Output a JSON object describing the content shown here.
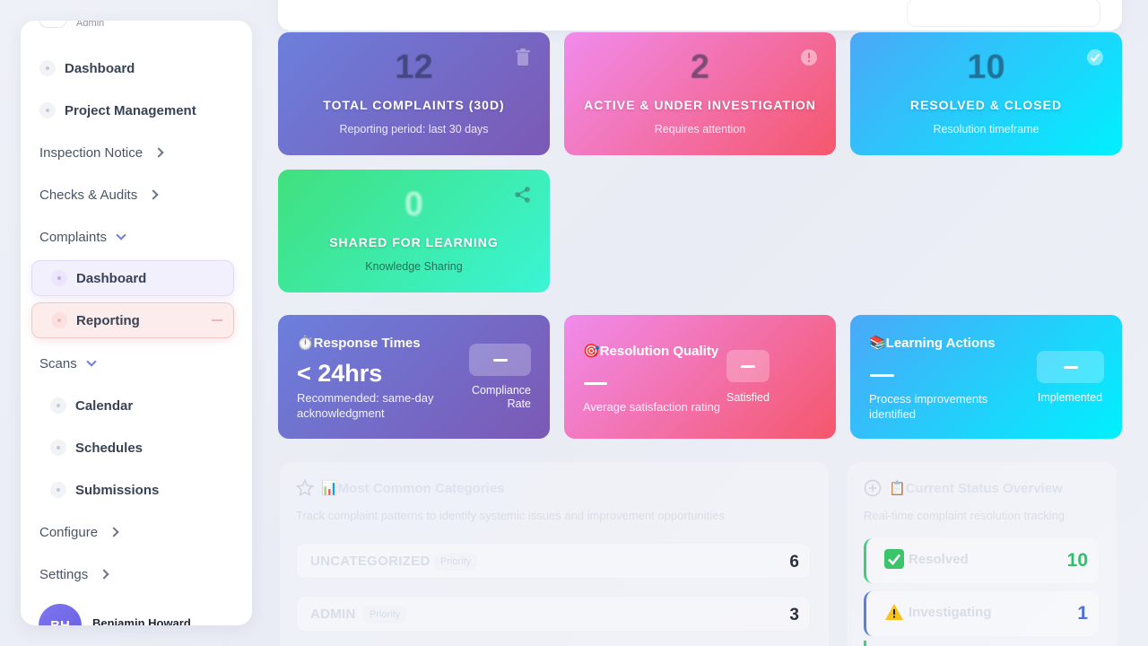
{
  "sidebar": {
    "top_role": "Admin",
    "items": [
      {
        "label": "Dashboard"
      },
      {
        "label": "Project Management"
      },
      {
        "label": "Inspection Notice"
      },
      {
        "label": "Checks & Audits"
      },
      {
        "label": "Complaints"
      },
      {
        "label": "Dashboard"
      },
      {
        "label": "Reporting"
      },
      {
        "label": "Scans"
      },
      {
        "label": "Calendar"
      },
      {
        "label": "Schedules"
      },
      {
        "label": "Submissions"
      },
      {
        "label": "Configure"
      },
      {
        "label": "Settings"
      }
    ],
    "user": {
      "initials": "BH",
      "name": "Benjamin Howard"
    }
  },
  "stats": [
    {
      "value": "12",
      "label": "TOTAL COMPLAINTS (30D)",
      "sub": "Reporting period: last 30 days",
      "icon": "trash-icon"
    },
    {
      "value": "2",
      "label": "ACTIVE & UNDER INVESTIGATION",
      "sub": "Requires attention",
      "icon": "alert-circle-icon"
    },
    {
      "value": "10",
      "label": "RESOLVED & CLOSED",
      "sub": "Resolution timeframe",
      "icon": "check-circle-icon"
    },
    {
      "value": "0",
      "label": "SHARED FOR LEARNING",
      "sub": "Knowledge Sharing",
      "icon": "share-icon"
    }
  ],
  "metrics": {
    "response": {
      "title": "⏱️Response Times",
      "value": "< 24hrs",
      "desc": "Recommended: same-day acknowledgment",
      "box_label": "Compliance Rate"
    },
    "quality": {
      "title": "🎯Resolution Quality",
      "desc": "Average satisfaction rating",
      "box_label": "Satisfied"
    },
    "learning": {
      "title": "📚Learning Actions",
      "desc": "Process improvements identified",
      "box_label": "Implemented"
    }
  },
  "categories": {
    "title": "📊Most Common Categories",
    "subtitle": "Track complaint patterns to identify systemic issues and improvement opportunities",
    "rows": [
      {
        "name": "UNCATEGORIZED",
        "priority": "Priority",
        "count": "6"
      },
      {
        "name": "ADMIN",
        "priority": "Priority",
        "count": "3"
      }
    ]
  },
  "status": {
    "title": "📋Current Status Overview",
    "subtitle": "Real-time complaint resolution tracking",
    "rows": [
      {
        "name": "Resolved",
        "count": "10",
        "color": "#2fc06a",
        "icon": "check-mark-emoji-icon"
      },
      {
        "name": "Investigating",
        "count": "1",
        "color": "#4a6fe0",
        "icon": "warning-emoji-icon"
      }
    ]
  },
  "colors": {
    "purple": "#6c7fdc",
    "pink": "#f5576c",
    "cyan": "#00f0fe",
    "green": "#40e07c",
    "accent": "#6c7ed8"
  }
}
